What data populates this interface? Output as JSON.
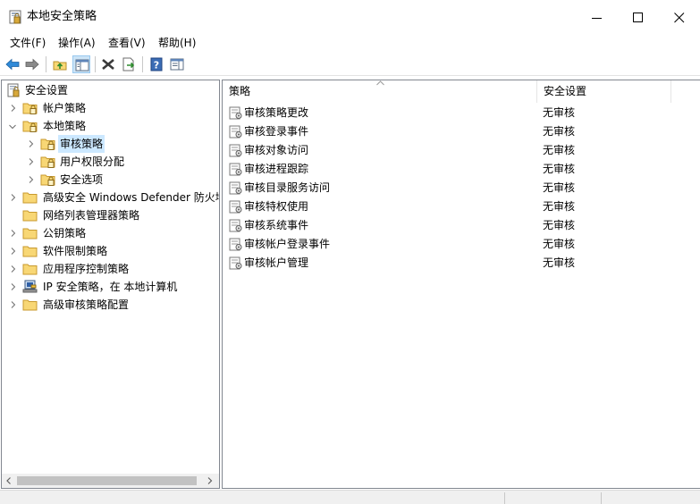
{
  "window": {
    "title": "本地安全策略"
  },
  "menu": [
    {
      "label": "文件(F)"
    },
    {
      "label": "操作(A)"
    },
    {
      "label": "查看(V)"
    },
    {
      "label": "帮助(H)"
    }
  ],
  "toolbar": {
    "buttons": [
      {
        "icon": "back-arrow-icon"
      },
      {
        "icon": "forward-arrow-icon"
      },
      {
        "icon": "up-folder-icon"
      },
      {
        "icon": "show-hide-tree-icon"
      },
      {
        "icon": "delete-x-icon"
      },
      {
        "icon": "export-list-icon"
      },
      {
        "icon": "help-icon"
      },
      {
        "icon": "properties-pane-icon"
      }
    ]
  },
  "tree": {
    "items": [
      {
        "label": "安全设置",
        "level": 0,
        "expanded": true,
        "icon": "security-settings-icon"
      },
      {
        "label": "帐户策略",
        "level": 1,
        "expanded": false,
        "icon": "folder-lock-icon"
      },
      {
        "label": "本地策略",
        "level": 1,
        "expanded": true,
        "icon": "folder-lock-icon"
      },
      {
        "label": "审核策略",
        "level": 2,
        "expanded": false,
        "icon": "folder-lock-icon",
        "selected": true
      },
      {
        "label": "用户权限分配",
        "level": 2,
        "expanded": false,
        "icon": "folder-lock-icon"
      },
      {
        "label": "安全选项",
        "level": 2,
        "expanded": false,
        "icon": "folder-lock-icon"
      },
      {
        "label": "高级安全 Windows Defender 防火墙",
        "level": 1,
        "expanded": false,
        "icon": "folder-icon"
      },
      {
        "label": "网络列表管理器策略",
        "level": 1,
        "expanded": null,
        "icon": "folder-icon"
      },
      {
        "label": "公钥策略",
        "level": 1,
        "expanded": false,
        "icon": "folder-icon"
      },
      {
        "label": "软件限制策略",
        "level": 1,
        "expanded": false,
        "icon": "folder-icon"
      },
      {
        "label": "应用程序控制策略",
        "level": 1,
        "expanded": false,
        "icon": "folder-icon"
      },
      {
        "label": "IP 安全策略，在 本地计算机",
        "level": 1,
        "expanded": false,
        "icon": "ip-security-icon"
      },
      {
        "label": "高级审核策略配置",
        "level": 1,
        "expanded": false,
        "icon": "folder-icon"
      }
    ]
  },
  "list": {
    "columns": [
      "策略",
      "安全设置"
    ],
    "rows": [
      {
        "name": "审核策略更改",
        "value": "无审核"
      },
      {
        "name": "审核登录事件",
        "value": "无审核"
      },
      {
        "name": "审核对象访问",
        "value": "无审核"
      },
      {
        "name": "审核进程跟踪",
        "value": "无审核"
      },
      {
        "name": "审核目录服务访问",
        "value": "无审核"
      },
      {
        "name": "审核特权使用",
        "value": "无审核"
      },
      {
        "name": "审核系统事件",
        "value": "无审核"
      },
      {
        "name": "审核帐户登录事件",
        "value": "无审核"
      },
      {
        "name": "审核帐户管理",
        "value": "无审核"
      }
    ]
  },
  "colors": {
    "selection": "#cce8ff",
    "folder": "#f8d775",
    "toolbar_pressed": "#cce4f7"
  }
}
